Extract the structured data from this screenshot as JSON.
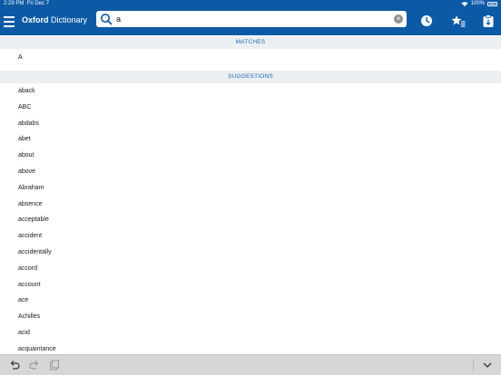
{
  "status": {
    "time": "2:29 PM",
    "date": "Fri Dec 7",
    "battery": "100%"
  },
  "app": {
    "title_bold": "Oxford",
    "title_rest": " Dictionary"
  },
  "search": {
    "value": "a"
  },
  "sections": {
    "matches": "MATCHES",
    "suggestions": "SUGGESTIONS"
  },
  "matches": [
    "A"
  ],
  "suggestions": [
    "aback",
    "ABC",
    "abdabs",
    "abet",
    "about",
    "above",
    "Abraham",
    "absence",
    "acceptable",
    "accident",
    "accidentally",
    "accord",
    "account",
    "ace",
    "Achilles",
    "acid",
    "acquaintance"
  ],
  "colors": {
    "accent": "#0c5aa6",
    "section_bg": "#edf0f3",
    "section_text": "#1f68b4",
    "toolbar": "#d5d6d8"
  },
  "icons": [
    "menu-icon",
    "search-icon",
    "clear-icon",
    "history-icon",
    "favorites-icon",
    "flashcards-icon",
    "undo-icon",
    "redo-icon",
    "copy-icon",
    "chevron-down-icon"
  ]
}
